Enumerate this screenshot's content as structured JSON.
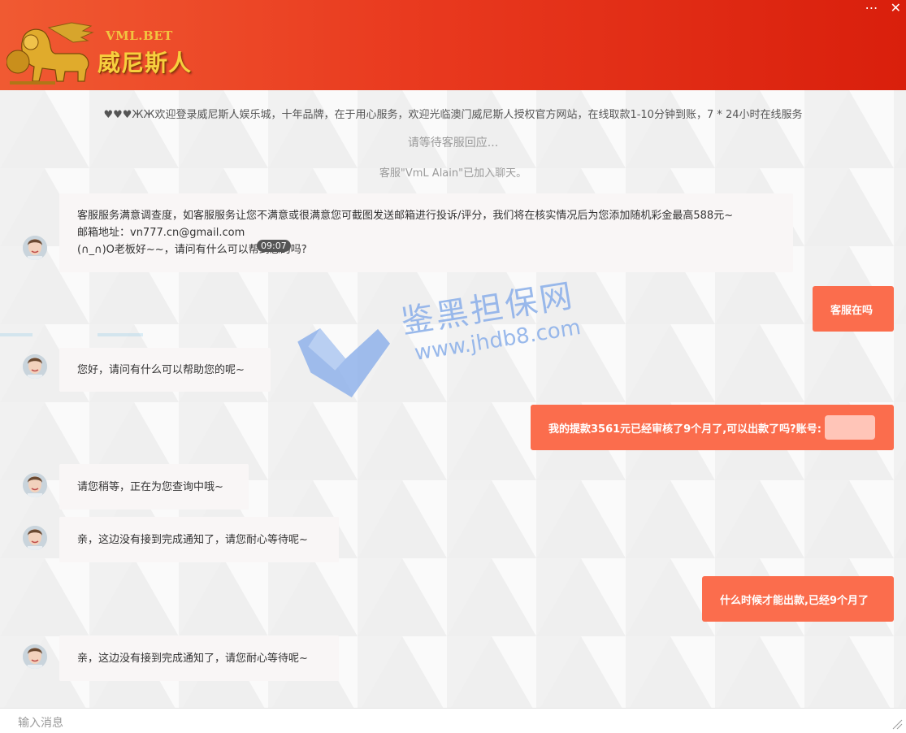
{
  "header": {
    "brand_en": "VML.BET",
    "brand_cn": "威尼斯人",
    "menu_icon": "ellipsis-icon",
    "close_icon": "close-icon"
  },
  "system": {
    "notice": "♥♥♥ЖЖ欢迎登录威尼斯人娱乐城，十年品牌，在于用心服务，欢迎光临澳门威尼斯人授权官方网站，在线取款1-10分钟到账，7 * 24小时在线服务",
    "waiting": "请等待客服回应...",
    "joined": "客服\"VmL Alain\"已加入聊天。"
  },
  "messages": {
    "m1": {
      "line1": "客服服务满意调查度，如客服服务让您不满意或很满意您可截图发送邮箱进行投诉/评分，我们将在核实情况后为您添加随机彩金最高588元~",
      "line2": "邮箱地址：vn777.cn@gmail.com",
      "line3": "(∩_∩)O老板好~~，请问有什么可以帮到您的吗?",
      "time": "09:07"
    },
    "u1": "客服在吗",
    "m2": "您好，请问有什么可以帮助您的呢~",
    "u2": "我的提款3561元已经审核了9个月了,可以出款了吗?账号:",
    "m3": "请您稍等，正在为您查询中哦~",
    "m4": "亲，这边没有接到完成通知了，请您耐心等待呢~",
    "u3": "什么时候才能出款,已经9个月了",
    "m5": "亲，这边没有接到完成通知了，请您耐心等待呢~"
  },
  "watermark": {
    "cn": "鉴黑担保网",
    "url": "www.jhdb8.com"
  },
  "input": {
    "placeholder": "输入消息"
  },
  "colors": {
    "header_start": "#f05a32",
    "header_end": "#d91f0c",
    "user_bubble": "#fb6d4d",
    "agent_bubble": "#f9f6f6"
  }
}
